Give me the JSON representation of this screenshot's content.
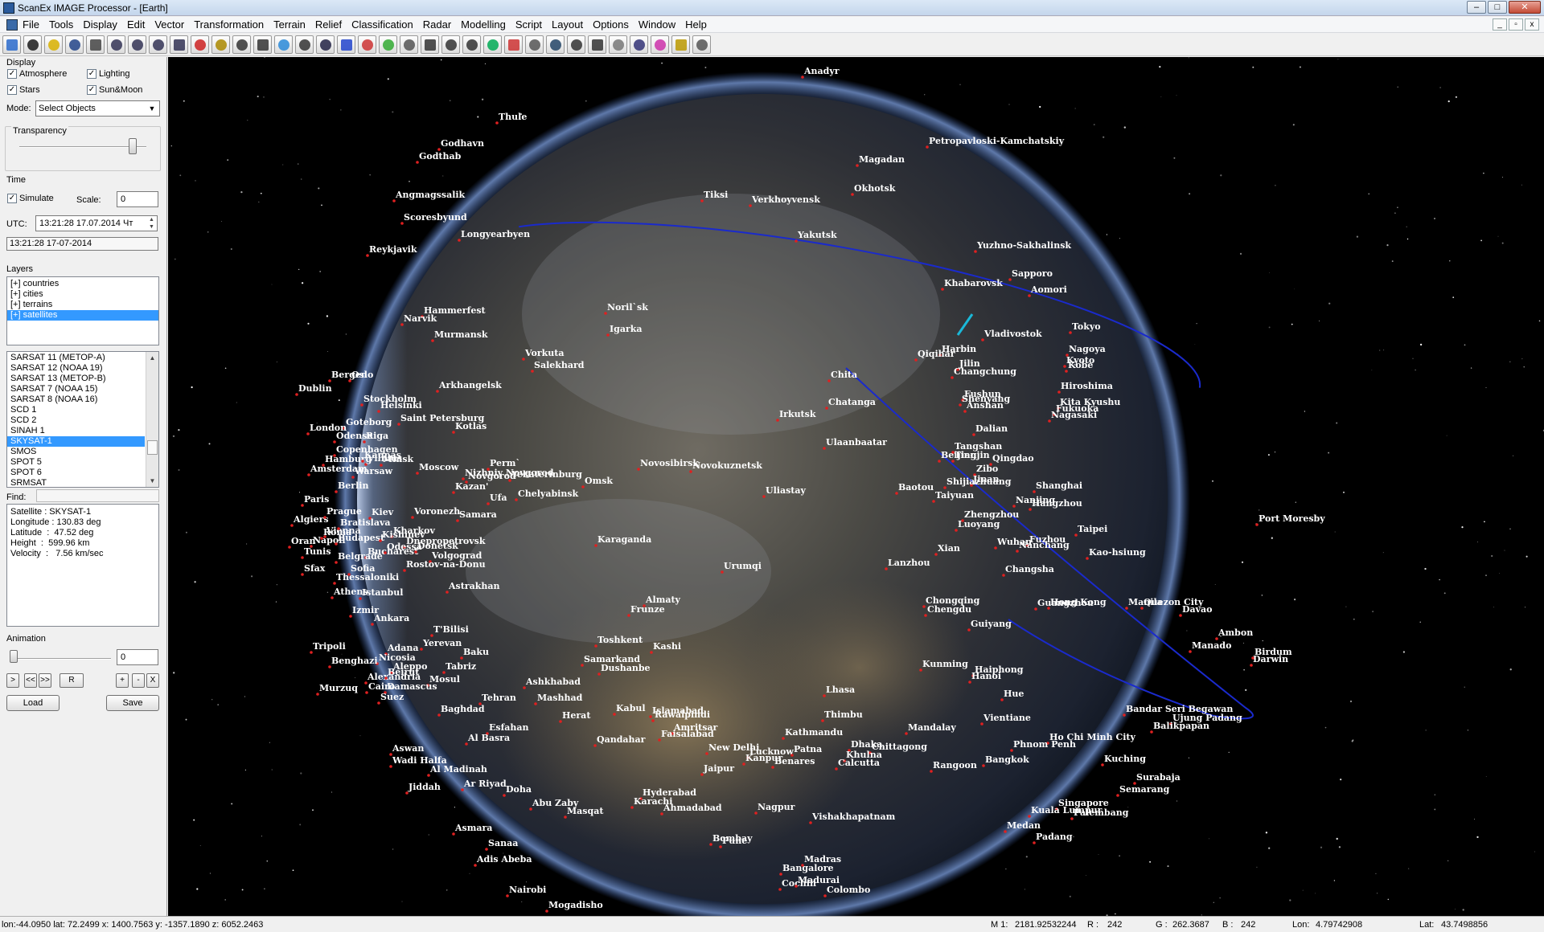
{
  "window": {
    "title": "ScanEx IMAGE Processor - [Earth]"
  },
  "menu": [
    "File",
    "Tools",
    "Display",
    "Edit",
    "Vector",
    "Transformation",
    "Terrain",
    "Relief",
    "Classification",
    "Radar",
    "Modelling",
    "Script",
    "Layout",
    "Options",
    "Window",
    "Help"
  ],
  "toolbar_icons": [
    "open-icon",
    "save-icon",
    "palette-icon",
    "monitor-icon",
    "pan-hand-icon",
    "zoom-icon",
    "zoom-in-icon",
    "zoom-out-icon",
    "zoom-fit-icon",
    "zoom-region-icon",
    "ruler-icon",
    "select-rect-icon",
    "contrast-icon",
    "frame-icon",
    "cursor-icon",
    "info-icon",
    "histogram-icon",
    "rgb-icon",
    "layers-icon",
    "gradient-icon",
    "copy-icon",
    "split-icon",
    "text-ab-icon",
    "vector-edit-icon",
    "path-icon",
    "grid-icon",
    "globe-icon",
    "crop-icon",
    "mosaic-icon",
    "target-icon",
    "register-icon",
    "filter-icon",
    "settings-icon",
    "table-icon"
  ],
  "display": {
    "label": "Display",
    "atmosphere": "Atmosphere",
    "lighting": "Lighting",
    "stars": "Stars",
    "sunmoon": "Sun&Moon",
    "mode_label": "Mode:",
    "mode_value": "Select Objects",
    "transparency_label": "Transparency",
    "transparency_level": 0.9
  },
  "time": {
    "label": "Time",
    "simulate": "Simulate",
    "scale_label": "Scale:",
    "scale_value": "0",
    "utc_label": "UTC:",
    "utc_value": "13:21:28  17.07.2014 Чт",
    "current": "13:21:28  17-07-2014"
  },
  "layers": {
    "label": "Layers",
    "items": [
      "[+] countries",
      "[+] cities",
      "[+] terrains",
      "[+] satellites"
    ],
    "selected_index": 3
  },
  "satellites": {
    "items": [
      "SARSAT 11 (METOP-A)",
      "SARSAT 12 (NOAA 19)",
      "SARSAT 13 (METOP-B)",
      "SARSAT 7 (NOAA 15)",
      "SARSAT 8 (NOAA 16)",
      "SCD 1",
      "SCD 2",
      "SINAH 1",
      "SKYSAT-1",
      "SMOS",
      "SPOT 5",
      "SPOT 6",
      "SRMSAT"
    ],
    "selected_index": 8
  },
  "find": {
    "label": "Find:",
    "info": [
      "Satellite : SKYSAT-1",
      "Longitude : 130.83 deg",
      "Latitude  :  47.52 deg",
      "Height  :  599.96 km",
      "Velocity  :   7.56 km/sec"
    ]
  },
  "animation": {
    "label": "Animation",
    "value": "0",
    "buttons": [
      ">",
      "<<",
      ">>",
      "R",
      "+",
      "-",
      "X"
    ],
    "load": "Load",
    "save": "Save"
  },
  "status": {
    "coords": "lon:-44.0950 lat: 72.2499 x: 1400.7563 y: -1357.1890 z: 6052.2463",
    "m1_label": "M 1:",
    "m1_value": "2181.92532244",
    "r_label": "R :",
    "r_value": "242",
    "g_label": "G :",
    "g_value": "262.3687",
    "b_label": "B :",
    "b_value": "242",
    "lon_label": "Lon:",
    "lon_value": "4.79742908",
    "lat_label": "Lat:",
    "lat_value": "43.7498856"
  },
  "cities": [
    "Anadyr",
    "Thule",
    "Godhavn",
    "Godthab",
    "Petropavloski-Kamchatskiy",
    "Magadan",
    "Okhotsk",
    "Tiksi",
    "Verkhoyvensk",
    "Angmagssalik",
    "Scoresbyund",
    "Yakutsk",
    "Longyearbyen",
    "Reykjavik",
    "Yuzhno-Sakhalinsk",
    "Khabarovsk",
    "Sapporo",
    "Aomori",
    "Hammerfest",
    "Narvik",
    "Noril`sk",
    "Murmansk",
    "Igarka",
    "Vladivostok",
    "Tokyo",
    "Nagoya",
    "Vorkuta",
    "Salekhard",
    "Harbin",
    "Qiqihar",
    "Jilin",
    "Changchung",
    "Kyoto",
    "Kobe",
    "Oslo",
    "Chita",
    "Hiroshima",
    "Arkhangelsk",
    "Stockholm",
    "Fushun",
    "Shenyang",
    "Anshan",
    "Kita Kyushu",
    "Fukuoka",
    "Nagasaki",
    "Helsinki",
    "Saint Petersburg",
    "Kotlas",
    "Chatanga",
    "Irkutsk",
    "Dalian",
    "Riga",
    "Ulaanbaatar",
    "Tangshan",
    "Beijing",
    "Tianjin",
    "Qingdao",
    "Vilnius",
    "Perm`",
    "Zibo",
    "Novosibirsk",
    "Novokuznetsk",
    "Yekaterinburg",
    "Novgorod",
    "Omsk",
    "Jinan",
    "Shijiazhuang",
    "Kazan'",
    "Baotou",
    "Shanghai",
    "Uliastay",
    "Chelyabinsk",
    "Ufa",
    "Taiyuan",
    "Nanjing",
    "Hangzhou",
    "Kiev",
    "Samara",
    "Zhengzhou",
    "Luoyang",
    "Port Moresby",
    "Kharkov",
    "Fuzhou",
    "Taipei",
    "Dnepropetrovsk",
    "Wuhan",
    "Nanchang",
    "Kao-hsiung",
    "Karaganda",
    "Xian",
    "Volgograd",
    "Rostov-na-Donu",
    "Urumqi",
    "Lanzhou",
    "Changsha",
    "Thessaloniki",
    "Istanbul",
    "Astrakhan",
    "Almaty",
    "Frunze",
    "Chongqing",
    "Chengdu",
    "Guangzhou",
    "Hong Kong",
    "Manila",
    "Quezon City",
    "Davao",
    "Guiyang",
    "Ankara",
    "T'Bilisi",
    "Yerevan",
    "Toshkent",
    "Baku",
    "Kashi",
    "Ambon",
    "Samarkand",
    "Dushanbe",
    "Kunming",
    "Haiphong",
    "Hanoi",
    "Tabriz",
    "Mosul",
    "Ashkhabad",
    "Manado",
    "Birdum",
    "Darwin",
    "Aleppo",
    "Damascus",
    "Tehran",
    "Mashhad",
    "Lhasa",
    "Baghdad",
    "Kabul",
    "Islamabad",
    "Rawalpindi",
    "Hue",
    "Bandar Seri Begawan",
    "Vientiane",
    "Thimbu",
    "Mandalay",
    "Esfahan",
    "Herat",
    "Amritsar",
    "Faisalabad",
    "Kathmandu",
    "Ujung Padang",
    "Balikpapan",
    "Al Basra",
    "Qandahar",
    "New Delhi",
    "Lucknow",
    "Dhaka",
    "Chittagong",
    "Ho Chi Minh City",
    "Phnom Penh",
    "Aswan",
    "Wadi Halfa",
    "Patna",
    "Khulna",
    "Calcutta",
    "Benares",
    "Kanpur",
    "Bangkok",
    "Rangoon",
    "Kuching",
    "Jaipur",
    "Al Madinah",
    "Surabaja",
    "Semarang",
    "Jiddah",
    "Ar Riyad",
    "Doha",
    "Hyderabad",
    "Karachi",
    "Ahmadabad",
    "Nagpur",
    "Abu Zaby",
    "Masqat",
    "Vishakhapatnam",
    "Singapore",
    "Kuala Lumpur",
    "Palembang",
    "Medan",
    "Padang",
    "Asmara",
    "Bombay",
    "Pune",
    "Madras",
    "Bangalore",
    "Cochin",
    "Madurai",
    "Colombo",
    "Sanaa",
    "Adis Abeba",
    "Nairobi",
    "Mogadisho",
    "Algiers",
    "Tunis",
    "Napoli",
    "Roma",
    "Sfax",
    "Cairo",
    "Alexandria",
    "Suez",
    "Izmir",
    "Adana",
    "Nicosia",
    "Beirut",
    "Athens",
    "Warsaw",
    "Minsk",
    "Bucharest",
    "Sofia",
    "Belgrade",
    "Budapest",
    "Vienna",
    "Prague",
    "Berlin",
    "Copenhagen",
    "Goteborg",
    "Odense",
    "Hamburg",
    "Amsterdam",
    "London",
    "Paris",
    "Dublin",
    "Bergen",
    "Oran",
    "Murzuq",
    "Benghazi",
    "Tripoli",
    "Bratislava",
    "Kishinev",
    "Odessa",
    "Donetsk",
    "Kaunas",
    "Moscow",
    "Nizhniy Novgorod",
    "Voronezh"
  ]
}
